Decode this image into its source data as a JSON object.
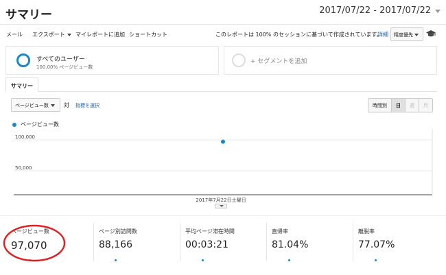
{
  "header": {
    "title": "サマリー",
    "date_range": "2017/07/22 - 2017/07/22"
  },
  "toolbar": {
    "items": [
      "メール",
      "エクスポート",
      "マイレポートに追加",
      "ショートカット"
    ],
    "sampling_note": "このレポートは 100% のセッションに基づいて作成されています。",
    "details_link": "詳細",
    "accuracy_label": "精度優先",
    "cap_icon": "graduation-cap-icon"
  },
  "segments": {
    "all_users": {
      "title": "すべてのユーザー",
      "subtitle": "100.00% ページビュー数"
    },
    "add_segment": "+ セグメントを追加"
  },
  "tabs": [
    "サマリー"
  ],
  "chart_controls": {
    "metric": "ページビュー数",
    "vs": "対",
    "pick_metric": "指標を選択",
    "granularity": [
      "時間別",
      "日",
      "週",
      "月"
    ],
    "active_granularity": "日"
  },
  "chart_data": {
    "type": "scatter",
    "series": [
      {
        "name": "ページビュー数",
        "color": "#1a87c9",
        "x": [
          "2017年7月22日土曜日"
        ],
        "y": [
          97070
        ]
      }
    ],
    "y_ticks": [
      "100,000",
      "50,000"
    ],
    "y_tick_values": [
      100000,
      50000
    ],
    "ylim": [
      0,
      120000
    ],
    "x_label": "2017年7月22日土曜日",
    "grid": true
  },
  "metrics": [
    {
      "label": "ページビュー数",
      "value": "97,070"
    },
    {
      "label": "ページ別訪問数",
      "value": "88,166"
    },
    {
      "label": "平均ページ滞在時間",
      "value": "00:03:21"
    },
    {
      "label": "直帰率",
      "value": "81.04%"
    },
    {
      "label": "離脱率",
      "value": "77.07%"
    }
  ],
  "colors": {
    "accent": "#1a87c9",
    "link": "#1a5fa8",
    "highlight": "#e02020"
  }
}
